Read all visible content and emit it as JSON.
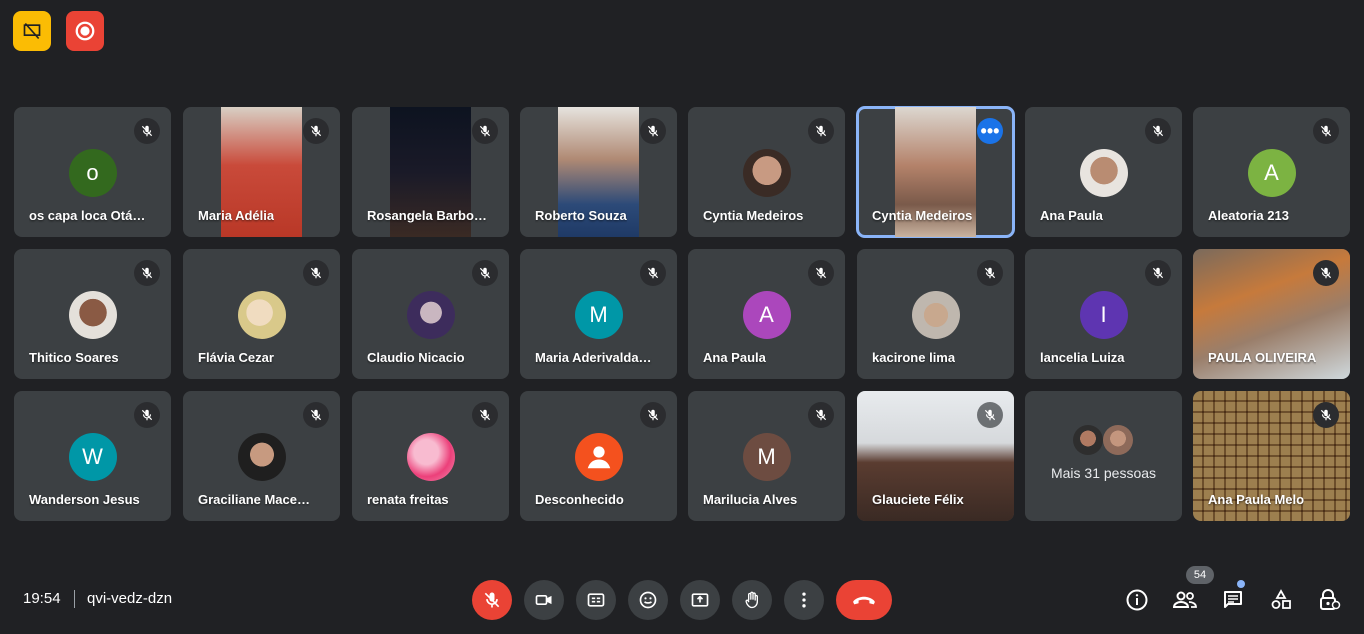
{
  "top_badges": [
    {
      "icon": "presentation-hidden-icon",
      "color": "#fbbc04"
    },
    {
      "icon": "recording-icon",
      "color": "#ea4335"
    }
  ],
  "participants": [
    {
      "name": "os capa loca Otá…",
      "kind": "letter",
      "letter": "o",
      "color": "#33691e"
    },
    {
      "name": "Maria Adélia",
      "kind": "video"
    },
    {
      "name": "Rosangela Barbo…",
      "kind": "video"
    },
    {
      "name": "Roberto Souza",
      "kind": "video"
    },
    {
      "name": "Cyntia Medeiros",
      "kind": "photo"
    },
    {
      "name": "Cyntia Medeiros",
      "kind": "video",
      "active": true
    },
    {
      "name": "Ana Paula",
      "kind": "photo"
    },
    {
      "name": "Aleatoria 213",
      "kind": "letter",
      "letter": "A",
      "color": "#7cb342"
    },
    {
      "name": "Thitico Soares",
      "kind": "photo"
    },
    {
      "name": "Flávia Cezar",
      "kind": "photo"
    },
    {
      "name": "Claudio Nicacio",
      "kind": "photo"
    },
    {
      "name": "Maria Aderivalda…",
      "kind": "letter",
      "letter": "M",
      "color": "#0097a7"
    },
    {
      "name": "Ana Paula",
      "kind": "letter",
      "letter": "A",
      "color": "#ab47bc"
    },
    {
      "name": "kacirone lima",
      "kind": "photo"
    },
    {
      "name": "lancelia Luiza",
      "kind": "letter",
      "letter": "I",
      "color": "#5e35b1"
    },
    {
      "name": "PAULA OLIVEIRA",
      "kind": "video"
    },
    {
      "name": "Wanderson Jesus",
      "kind": "letter",
      "letter": "W",
      "color": "#0097a7"
    },
    {
      "name": "Graciliane Mace…",
      "kind": "photo"
    },
    {
      "name": "renata freitas",
      "kind": "photo"
    },
    {
      "name": "Desconhecido",
      "kind": "anon",
      "color": "#f4511e"
    },
    {
      "name": "Marilucia Alves",
      "kind": "letter",
      "letter": "M",
      "color": "#6d4c41"
    },
    {
      "name": "Glauciete Félix",
      "kind": "video"
    },
    {
      "name": "Mais 31 pessoas",
      "kind": "more"
    },
    {
      "name": "Ana Paula Melo",
      "kind": "video"
    }
  ],
  "meeting": {
    "time": "19:54",
    "code": "qvi-vedz-dzn"
  },
  "controls": {
    "mic": "mic-off-icon",
    "camera": "camera-icon",
    "captions": "captions-icon",
    "reactions": "emoji-icon",
    "present": "present-screen-icon",
    "raise_hand": "raise-hand-icon",
    "more": "more-options-icon",
    "leave": "hang-up-icon"
  },
  "side_panel": {
    "participant_count": "54"
  }
}
